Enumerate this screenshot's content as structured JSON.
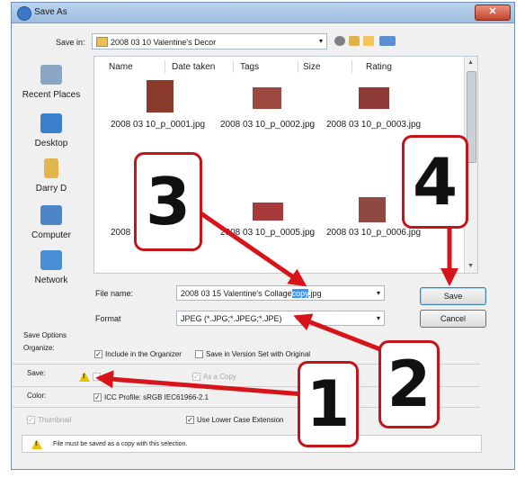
{
  "window": {
    "title": "Save As",
    "close_glyph": "✕"
  },
  "save_in": {
    "label": "Save in:",
    "folder": "2008 03 10 Valentine's Decor",
    "arrow": "▾"
  },
  "toolbar_icons": [
    "back-icon",
    "up-folder-icon",
    "new-folder-icon",
    "views-menu-icon"
  ],
  "places": [
    {
      "label": "Recent Places",
      "icon": "recent-places-icon",
      "color": "#8aa6c4"
    },
    {
      "label": "Desktop",
      "icon": "desktop-icon",
      "color": "#3b7fcf"
    },
    {
      "label": "Darry D",
      "icon": "user-folder-icon",
      "color": "#e2b64c"
    },
    {
      "label": "Computer",
      "icon": "computer-icon",
      "color": "#4d86c6"
    },
    {
      "label": "Network",
      "icon": "network-icon",
      "color": "#4a8ed3"
    }
  ],
  "columns": [
    "Name",
    "Date taken",
    "Tags",
    "Size",
    "Rating"
  ],
  "files": [
    {
      "name": "2008 03 10_p_0001.jpg",
      "color": "#8a3a2a"
    },
    {
      "name": "2008 03 10_p_0002.jpg",
      "color": "#9c4a40"
    },
    {
      "name": "2008 03 10_p_0003.jpg",
      "color": "#8f3b38"
    },
    {
      "name": "2008",
      "color": "#a84b4b"
    },
    {
      "name": "2008 03 10_p_0005.jpg",
      "color": "#a63a3a"
    },
    {
      "name": "2008 03 10_p_0006.jpg",
      "color": "#8e4a42"
    }
  ],
  "file_name": {
    "label": "File name:",
    "value_before": "2008 03 15 Valentine's Collage",
    "value_selected": "copy",
    "value_after": ".jpg"
  },
  "format": {
    "label": "Format",
    "value": "JPEG (*.JPG;*.JPEG;*.JPE)"
  },
  "buttons": {
    "save": "Save",
    "cancel": "Cancel"
  },
  "save_options": {
    "heading": "Save Options",
    "organize_label": "Organize:",
    "include_organizer": "Include in the Organizer",
    "version_set": "Save in Version Set with Original",
    "save_label": "Save:",
    "layers": "L",
    "as_copy": "As a Copy",
    "color_label": "Color:",
    "icc_profile": "ICC Profile:  sRGB IEC61966-2.1",
    "thumbnail": "Thumbnail",
    "lower_case": "Use Lower Case Extension"
  },
  "status": {
    "message": "File must be saved as a copy with this selection."
  },
  "callouts": [
    "1",
    "2",
    "3",
    "4"
  ],
  "accent_red": "#c4141a"
}
